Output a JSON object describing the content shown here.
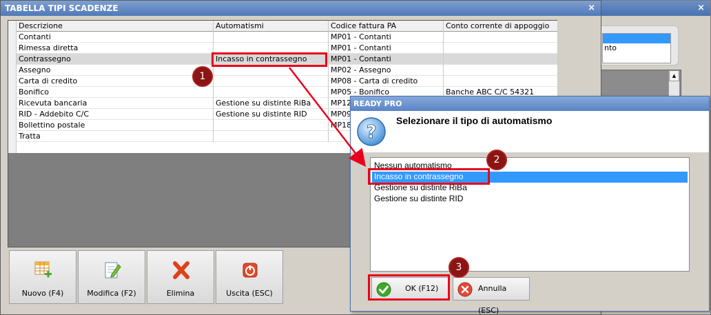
{
  "background_window": {
    "list_item": "nto"
  },
  "main_window": {
    "title": "TABELLA TIPI SCADENZE",
    "close_glyph": "×",
    "columns": [
      "Descrizione",
      "Automatismi",
      "Codice fattura PA",
      "Conto corrente di appoggio"
    ],
    "rows": [
      [
        "Contanti",
        "",
        "MP01 - Contanti",
        ""
      ],
      [
        "Rimessa diretta",
        "",
        "MP01 - Contanti",
        ""
      ],
      [
        "Contrassegno",
        "Incasso in contrassegno",
        "MP01 - Contanti",
        ""
      ],
      [
        "Assegno",
        "",
        "MP02 - Assegno",
        ""
      ],
      [
        "Carta di credito",
        "",
        "MP08 - Carta di credito",
        ""
      ],
      [
        "Bonifico",
        "",
        "MP05 - Bonifico",
        "Banche ABC C/C 54321"
      ],
      [
        "Ricevuta bancaria",
        "Gestione su distinte RiBa",
        "MP12",
        ""
      ],
      [
        "RID - Addebito C/C",
        "Gestione su distinte RID",
        "MP09",
        ""
      ],
      [
        "Bollettino postale",
        "",
        "MP18",
        ""
      ],
      [
        "Tratta",
        "",
        "",
        ""
      ]
    ],
    "buttons": [
      {
        "label": "Nuovo (F4)",
        "icon": "grid-add-icon"
      },
      {
        "label": "Modifica (F2)",
        "icon": "edit-document-icon"
      },
      {
        "label": "Elimina",
        "icon": "delete-x-icon"
      },
      {
        "label": "Uscita (ESC)",
        "icon": "exit-power-icon"
      }
    ]
  },
  "dialog": {
    "title": "READY PRO",
    "question": "Selezionare il tipo di automatismo",
    "options": [
      "Nessun automatismo",
      "Incasso in contrassegno",
      "Gestione su distinte RiBa",
      "Gestione su distinte RID"
    ],
    "selected_index": 1,
    "ok_label": "OK (F12)",
    "cancel_label": "Annulla (ESC)"
  },
  "annotations": {
    "badges": [
      "1",
      "2",
      "3"
    ],
    "color": "#e8001c"
  }
}
